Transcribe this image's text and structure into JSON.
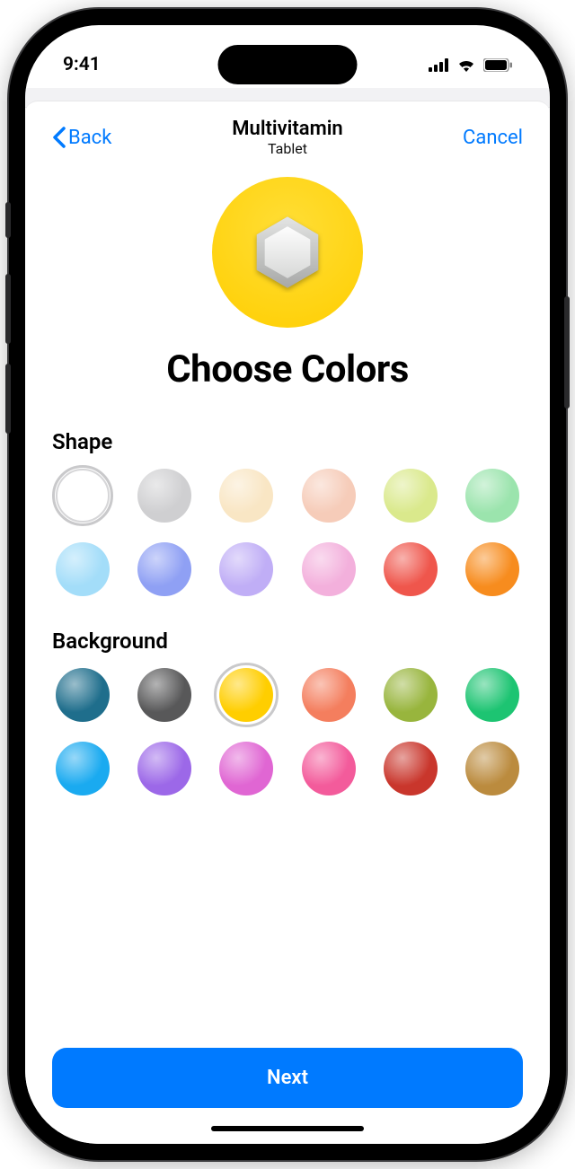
{
  "status": {
    "time": "9:41"
  },
  "nav": {
    "back_label": "Back",
    "title": "Multivitamin",
    "subtitle": "Tablet",
    "cancel_label": "Cancel"
  },
  "preview": {
    "background_color": "#ffce00",
    "background_gradient_top": "#ffde36",
    "shape_color": "#ffffff"
  },
  "page_title": "Choose Colors",
  "sections": {
    "shape": {
      "label": "Shape",
      "selected_index": 0,
      "colors": [
        "#ffffff",
        "#cfcfd1",
        "#f9e6c4",
        "#f6ccb9",
        "#dae98c",
        "#9be4ad",
        "#a3ddf9",
        "#8fa0f4",
        "#c0aef6",
        "#f3b0dc",
        "#ef564c",
        "#f78c1e"
      ]
    },
    "background": {
      "label": "Background",
      "selected_index": 2,
      "colors": [
        "#1f6e8c",
        "#585859",
        "#ffce00",
        "#f47e5e",
        "#98b53d",
        "#1dc472",
        "#1aaaf0",
        "#9c68e8",
        "#e066d3",
        "#f35b9b",
        "#c9362c",
        "#bb8b3e"
      ]
    }
  },
  "footer": {
    "next_label": "Next"
  }
}
